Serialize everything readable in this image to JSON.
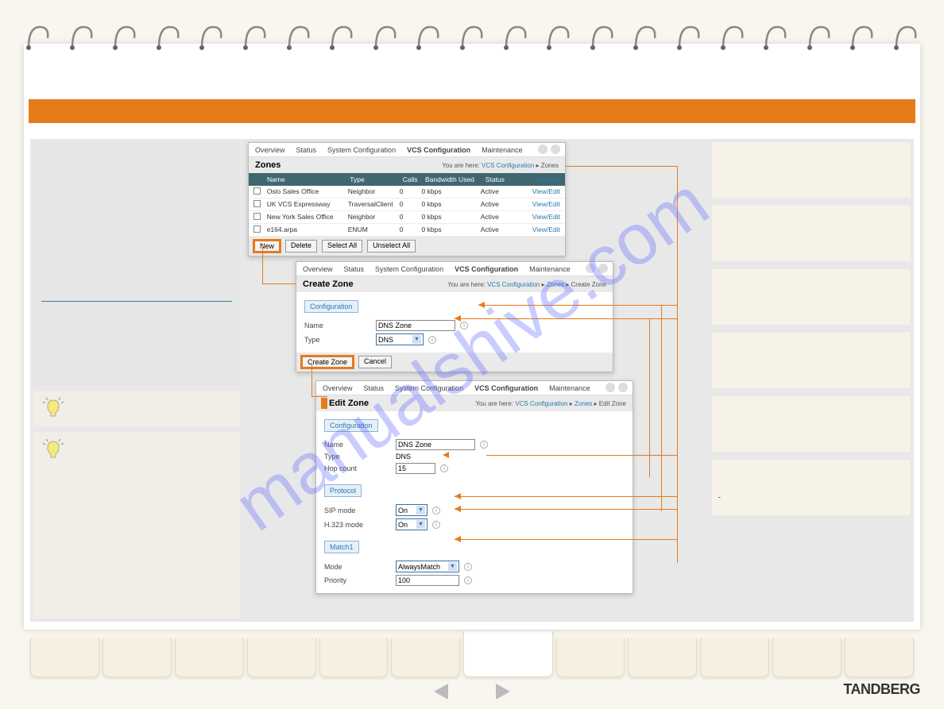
{
  "watermark": "manualshive.com",
  "brand": "TANDBERG",
  "menubar": {
    "items": [
      "Overview",
      "Status",
      "System Configuration",
      "VCS Configuration",
      "Maintenance"
    ],
    "bold_index": 3
  },
  "zones_panel": {
    "title": "Zones",
    "breadcrumb_pre": "You are here: ",
    "breadcrumb_links": [
      "VCS Configuration"
    ],
    "breadcrumb_tail": "Zones",
    "headers": [
      "Name",
      "Type",
      "Calls",
      "Bandwidth Used",
      "Status",
      "Actions"
    ],
    "rows": [
      {
        "name": "Oslo Sales Office",
        "type": "Neighbor",
        "calls": "0",
        "bw": "0 kbps",
        "status": "Active",
        "action": "View/Edit"
      },
      {
        "name": "UK VCS Expressway",
        "type": "TraversalClient",
        "calls": "0",
        "bw": "0 kbps",
        "status": "Active",
        "action": "View/Edit"
      },
      {
        "name": "New York Sales Office",
        "type": "Neighbor",
        "calls": "0",
        "bw": "0 kbps",
        "status": "Active",
        "action": "View/Edit"
      },
      {
        "name": "e164.arpa",
        "type": "ENUM",
        "calls": "0",
        "bw": "0 kbps",
        "status": "Active",
        "action": "View/Edit"
      }
    ],
    "buttons": {
      "new": "New",
      "delete": "Delete",
      "select_all": "Select All",
      "unselect_all": "Unselect All"
    }
  },
  "create_panel": {
    "title": "Create Zone",
    "breadcrumb_pre": "You are here: ",
    "breadcrumb_links": [
      "VCS Configuration",
      "Zones"
    ],
    "breadcrumb_tail": "Create Zone",
    "tab": "Configuration",
    "fields": {
      "name_lbl": "Name",
      "name_val": "DNS Zone",
      "type_lbl": "Type",
      "type_val": "DNS"
    },
    "buttons": {
      "create": "Create Zone",
      "cancel": "Cancel"
    }
  },
  "edit_panel": {
    "title": "Edit Zone",
    "breadcrumb_pre": "You are here: ",
    "breadcrumb_links": [
      "VCS Configuration",
      "Zones"
    ],
    "breadcrumb_tail": "Edit Zone",
    "tab_config": "Configuration",
    "tab_proto": "Protocol",
    "tab_match": "Match1",
    "fields": {
      "name_lbl": "Name",
      "name_val": "DNS Zone",
      "type_lbl": "Type",
      "type_val": "DNS",
      "hop_lbl": "Hop count",
      "hop_val": "15",
      "sip_lbl": "SIP mode",
      "sip_val": "On",
      "h323_lbl": "H.323 mode",
      "h323_val": "On",
      "mode_lbl": "Mode",
      "mode_val": "AlwaysMatch",
      "prio_lbl": "Priority",
      "prio_val": "100"
    }
  }
}
